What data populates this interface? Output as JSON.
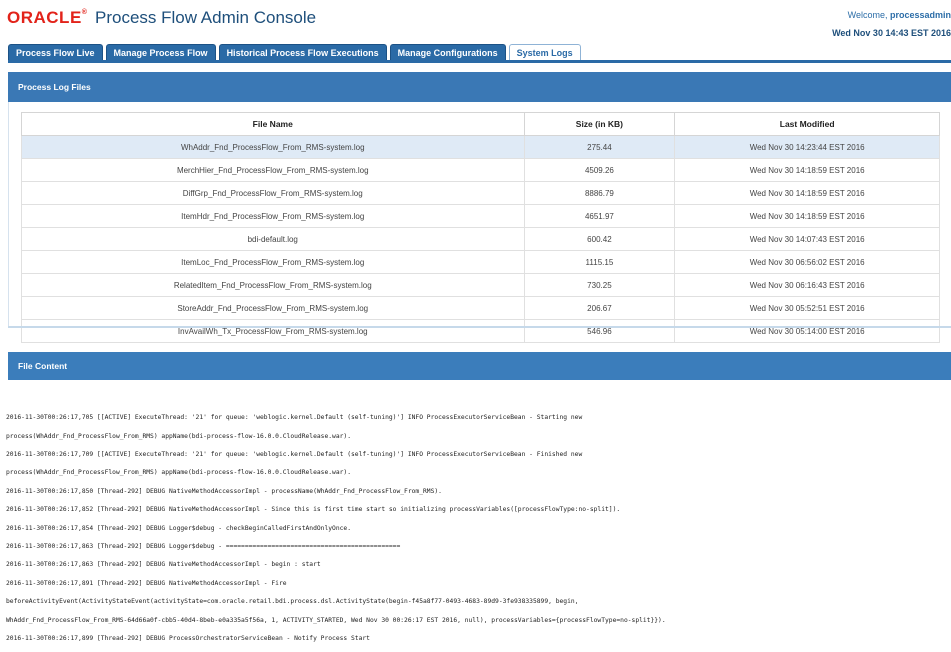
{
  "header": {
    "logo": "ORACLE",
    "title": "Process Flow Admin Console",
    "welcome_prefix": "Welcome, ",
    "user": "processadmin",
    "datetime": "Wed Nov 30 14:43 EST 2016"
  },
  "tabs": [
    {
      "label": "Process Flow Live"
    },
    {
      "label": "Manage Process Flow"
    },
    {
      "label": "Historical Process Flow Executions"
    },
    {
      "label": "Manage Configurations"
    },
    {
      "label": "System Logs"
    }
  ],
  "active_tab": 4,
  "logfiles": {
    "title": "Process Log Files",
    "columns": [
      "File Name",
      "Size (in KB)",
      "Last Modified"
    ],
    "rows": [
      {
        "name": "WhAddr_Fnd_ProcessFlow_From_RMS-system.log",
        "size": "275.44",
        "modified": "Wed Nov 30 14:23:44 EST 2016"
      },
      {
        "name": "MerchHier_Fnd_ProcessFlow_From_RMS-system.log",
        "size": "4509.26",
        "modified": "Wed Nov 30 14:18:59 EST 2016"
      },
      {
        "name": "DiffGrp_Fnd_ProcessFlow_From_RMS-system.log",
        "size": "8886.79",
        "modified": "Wed Nov 30 14:18:59 EST 2016"
      },
      {
        "name": "ItemHdr_Fnd_ProcessFlow_From_RMS-system.log",
        "size": "4651.97",
        "modified": "Wed Nov 30 14:18:59 EST 2016"
      },
      {
        "name": "bdi-default.log",
        "size": "600.42",
        "modified": "Wed Nov 30 14:07:43 EST 2016"
      },
      {
        "name": "ItemLoc_Fnd_ProcessFlow_From_RMS-system.log",
        "size": "1115.15",
        "modified": "Wed Nov 30 06:56:02 EST 2016"
      },
      {
        "name": "RelatedItem_Fnd_ProcessFlow_From_RMS-system.log",
        "size": "730.25",
        "modified": "Wed Nov 30 06:16:43 EST 2016"
      },
      {
        "name": "StoreAddr_Fnd_ProcessFlow_From_RMS-system.log",
        "size": "206.67",
        "modified": "Wed Nov 30 05:52:51 EST 2016"
      },
      {
        "name": "InvAvailWh_Tx_ProcessFlow_From_RMS-system.log",
        "size": "546.96",
        "modified": "Wed Nov 30 05:14:00 EST 2016"
      }
    ],
    "selected_row": 0
  },
  "file_content": {
    "title": "File Content",
    "lines": [
      "2016-11-30T00:26:17,705 [[ACTIVE] ExecuteThread: '21' for queue: 'weblogic.kernel.Default (self-tuning)'] INFO ProcessExecutorServiceBean - Starting new",
      "process(WhAddr_Fnd_ProcessFlow_From_RMS) appName(bdi-process-flow-16.0.0.CloudRelease.war).",
      "2016-11-30T00:26:17,709 [[ACTIVE] ExecuteThread: '21' for queue: 'weblogic.kernel.Default (self-tuning)'] INFO ProcessExecutorServiceBean - Finished new",
      "process(WhAddr_Fnd_ProcessFlow_From_RMS) appName(bdi-process-flow-16.0.0.CloudRelease.war).",
      "2016-11-30T00:26:17,850 [Thread-292] DEBUG NativeMethodAccessorImpl - processName(WhAddr_Fnd_ProcessFlow_From_RMS).",
      "2016-11-30T00:26:17,852 [Thread-292] DEBUG NativeMethodAccessorImpl - Since this is first time start so initializing processVariables([processFlowType:no-split]).",
      "2016-11-30T00:26:17,854 [Thread-292] DEBUG Logger$debug - checkBeginCalledFirstAndOnlyOnce.",
      "2016-11-30T00:26:17,863 [Thread-292] DEBUG Logger$debug - ==============================================",
      "2016-11-30T00:26:17,863 [Thread-292] DEBUG NativeMethodAccessorImpl - begin : start",
      "2016-11-30T00:26:17,891 [Thread-292] DEBUG NativeMethodAccessorImpl - Fire",
      "beforeActivityEvent(ActivityStateEvent(activityState=com.oracle.retail.bdi.process.dsl.ActivityState(begin-f45a8f77-0493-4683-89d9-3fe938335899, begin,",
      "WhAddr_Fnd_ProcessFlow_From_RMS-64d66a0f-cbb5-40d4-8beb-e0a335a5f56a, 1, ACTIVITY_STARTED, Wed Nov 30 00:26:17 EST 2016, null), processVariables={processFlowType=no-split}}).",
      "2016-11-30T00:26:17,899 [Thread-292] DEBUG ProcessOrchestratorServiceBean - Notify Process Start"
    ]
  }
}
